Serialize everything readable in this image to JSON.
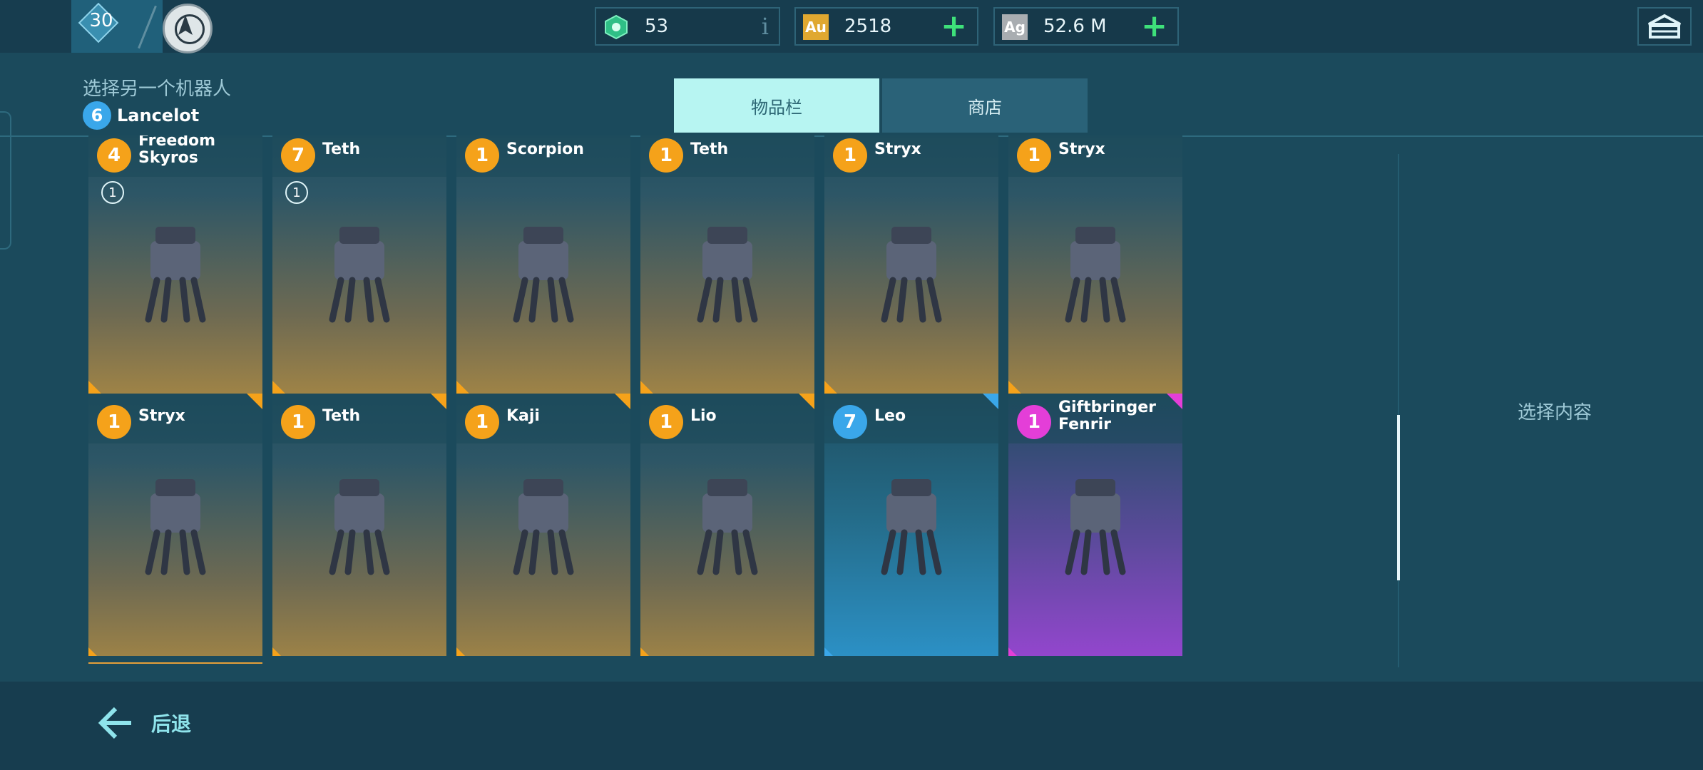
{
  "topbar": {
    "player_level": "30",
    "currencies": [
      {
        "name": "power-cells",
        "icon": "hex-cell-icon",
        "value": "53",
        "action": "i",
        "color": "#36c98a"
      },
      {
        "name": "gold",
        "icon_text": "Au",
        "value": "2518",
        "action": "+",
        "color": "#e0a830"
      },
      {
        "name": "silver",
        "icon_text": "Ag",
        "value": "52.6 M",
        "action": "+",
        "color": "#b8bcc0"
      }
    ]
  },
  "header": {
    "title": "选择另一个机器人",
    "current_robot": {
      "level": "6",
      "name": "Lancelot"
    },
    "tabs": [
      {
        "label": "物品栏",
        "active": true
      },
      {
        "label": "商店",
        "active": false
      }
    ]
  },
  "cards": [
    {
      "level": "4",
      "name": "Freedom Skyros",
      "rarity": "orange",
      "count": "1",
      "icon": "robot-freedom-skyros-icon"
    },
    {
      "level": "7",
      "name": "Teth",
      "rarity": "orange",
      "count": "1",
      "icon": "robot-teth-icon"
    },
    {
      "level": "1",
      "name": "Scorpion",
      "rarity": "orange",
      "count": "",
      "icon": "robot-scorpion-icon"
    },
    {
      "level": "1",
      "name": "Teth",
      "rarity": "orange",
      "count": "",
      "icon": "robot-teth-icon"
    },
    {
      "level": "1",
      "name": "Stryx",
      "rarity": "orange",
      "count": "",
      "icon": "robot-stryx-icon"
    },
    {
      "level": "1",
      "name": "Stryx",
      "rarity": "orange",
      "count": "",
      "icon": "robot-stryx-icon"
    },
    {
      "level": "1",
      "name": "Stryx",
      "rarity": "orange",
      "count": "",
      "icon": "robot-stryx-icon"
    },
    {
      "level": "1",
      "name": "Teth",
      "rarity": "orange",
      "count": "",
      "icon": "robot-teth-icon"
    },
    {
      "level": "1",
      "name": "Kaji",
      "rarity": "orange",
      "count": "",
      "icon": "robot-kaji-icon"
    },
    {
      "level": "1",
      "name": "Lio",
      "rarity": "orange",
      "count": "",
      "icon": "robot-lio-icon"
    },
    {
      "level": "7",
      "name": "Leo",
      "rarity": "blue",
      "count": "",
      "icon": "robot-leo-icon"
    },
    {
      "level": "1",
      "name": "Giftbringer Fenrir",
      "rarity": "purple",
      "count": "",
      "icon": "robot-giftbringer-fenrir-icon"
    }
  ],
  "right_panel": {
    "placeholder": "选择内容"
  },
  "footer": {
    "back_label": "后退"
  },
  "colors": {
    "bg": "#1b4a5c",
    "bar": "#173d4f",
    "tab_active": "#b7f5f2",
    "orange": "#f5a21a",
    "blue": "#3aa7ea",
    "pink": "#e43ed8",
    "plus_green": "#3ee07a"
  }
}
